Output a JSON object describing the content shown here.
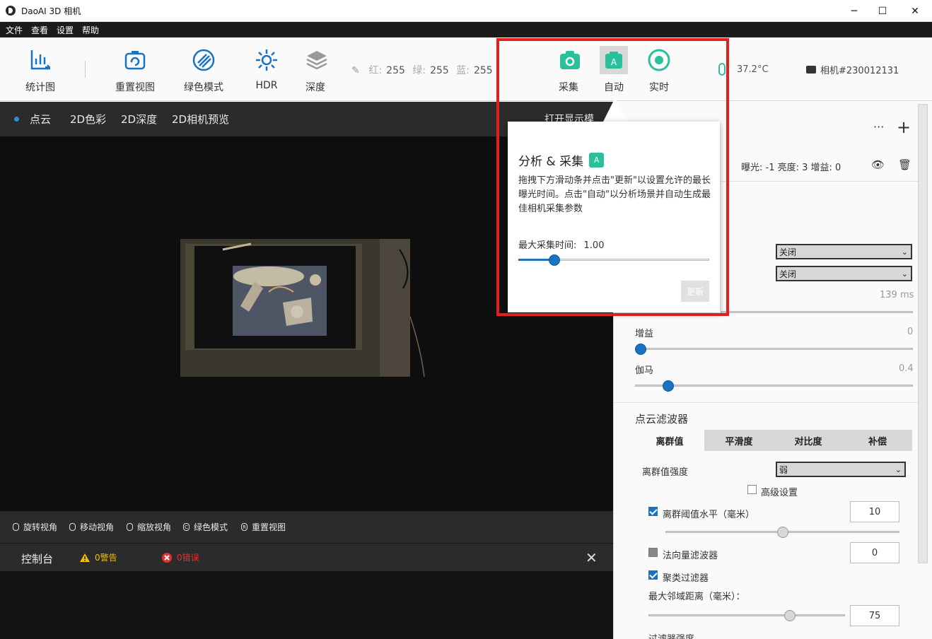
{
  "window": {
    "title": "DaoAI 3D 相机",
    "minimize": "─",
    "maximize": "☐",
    "close": "✕"
  },
  "menu": [
    "文件",
    "查看",
    "设置",
    "帮助"
  ],
  "toolbar": {
    "stats": "统计图",
    "reset_view": "重置视图",
    "green_mode": "绿色模式",
    "hdr": "HDR",
    "depth": "深度",
    "rgb": {
      "r_label": "红:",
      "r": "255",
      "g_label": "绿:",
      "g": "255",
      "b_label": "蓝:",
      "b": "255"
    },
    "capture": "采集",
    "auto": "自动",
    "realtime": "实时",
    "temperature": "37.2°C",
    "camera": "相机#230012131",
    "accent": "#2bbf9c"
  },
  "view_tabs": [
    "点云",
    "2D色彩",
    "2D深度",
    "2D相机预览"
  ],
  "viewer_hidden_label": "打开显示模",
  "nav": {
    "rotate": "旋转视角",
    "move": "移动视角",
    "zoom": "缩放视角",
    "green": "绿色模式",
    "reset": "重置视图",
    "rotate_key": "",
    "zoom_key": "",
    "green_key": "C",
    "reset_key": "R"
  },
  "console": {
    "title": "控制台",
    "warnings": "0警告",
    "errors": "0错误",
    "close": "✕"
  },
  "panel": {
    "more": "···",
    "add": "+",
    "params": "曝光: -1  亮度: 3  增益: 0",
    "select1": "关闭",
    "select2": "关闭",
    "exposure_value": "139 ms",
    "gain_label": "增益",
    "gain_value": "0",
    "gain_level": 0,
    "gamma_label": "伽马",
    "gamma_value": "0.4",
    "gamma_level": 0.12,
    "filter_title": "点云滤波器",
    "filter_tabs": [
      "离群值",
      "平滑度",
      "对比度",
      "补偿"
    ],
    "outlier_strength_label": "离群值强度",
    "outlier_strength": "弱",
    "advanced": "高级设置",
    "outlier_threshold_label": "离群阈值水平（毫米）",
    "outlier_threshold": "10",
    "outlier_threshold_level": 0.5,
    "normal_filter_label": "法向量滤波器",
    "normal_filter": "0",
    "cluster_filter_label": "聚类过滤器",
    "max_neighbor_label": "最大邻域距离（毫米）：",
    "max_neighbor": "75",
    "max_neighbor_level": 0.72,
    "filter_strength_label": "过滤器强度"
  },
  "popup": {
    "title": "分析 & 采集",
    "badge": "A",
    "description": "拖拽下方滑动条并点击\"更新\"以设置允许的最长曝光时间。点击\"自动\"以分析场景并自动生成最佳相机采集参数",
    "max_time_label": "最大采集时间:",
    "max_time_value": "1.00",
    "max_time_level": 0.19,
    "update": "更新"
  }
}
